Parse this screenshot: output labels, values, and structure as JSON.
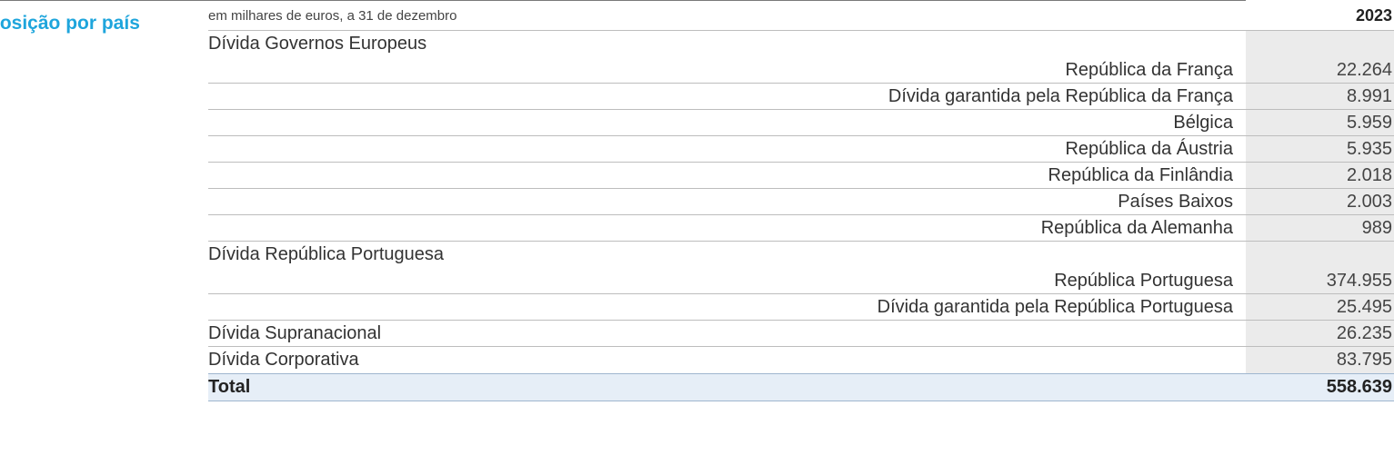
{
  "section_title": "posição por país",
  "table": {
    "unit_note": "em milhares de euros, a 31 de dezembro",
    "year_header": "2023",
    "rows": [
      {
        "label": "Dívida Governos Europeus",
        "value": "",
        "kind": "group"
      },
      {
        "label": "República da França",
        "value": "22.264",
        "kind": "sub"
      },
      {
        "label": "Dívida garantida pela República da França",
        "value": "8.991",
        "kind": "sub"
      },
      {
        "label": "Bélgica",
        "value": "5.959",
        "kind": "sub"
      },
      {
        "label": "República da Áustria",
        "value": "5.935",
        "kind": "sub"
      },
      {
        "label": "República da Finlândia",
        "value": "2.018",
        "kind": "sub"
      },
      {
        "label": "Países Baixos",
        "value": "2.003",
        "kind": "sub"
      },
      {
        "label": "República da Alemanha",
        "value": "989",
        "kind": "sub"
      },
      {
        "label": "Dívida República Portuguesa",
        "value": "",
        "kind": "group"
      },
      {
        "label": "República Portuguesa",
        "value": "374.955",
        "kind": "sub"
      },
      {
        "label": "Dívida garantida pela República Portuguesa",
        "value": "25.495",
        "kind": "sub"
      },
      {
        "label": "Dívida Supranacional",
        "value": "26.235",
        "kind": "group"
      },
      {
        "label": "Dívida Corporativa",
        "value": "83.795",
        "kind": "group"
      }
    ],
    "total": {
      "label": "Total",
      "value": "558.639"
    }
  },
  "colors": {
    "accent": "#1ea5dc",
    "value_column_bg": "#ebebeb",
    "total_row_bg": "#e6eef7"
  }
}
